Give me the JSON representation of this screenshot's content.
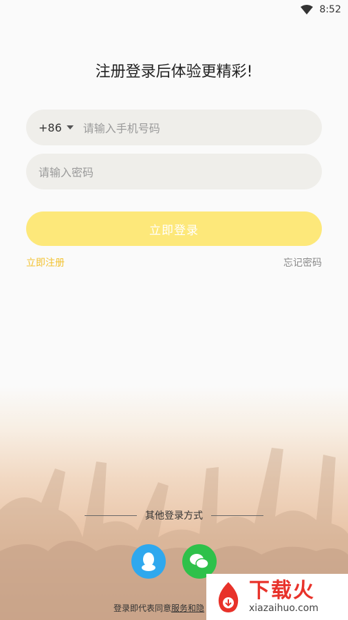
{
  "status_bar": {
    "time": "8:52"
  },
  "title": "注册登录后体验更精彩!",
  "phone_field": {
    "country_code": "+86",
    "placeholder": "请输入手机号码"
  },
  "password_field": {
    "placeholder": "请输入密码"
  },
  "login_button": "立即登录",
  "register_link": "立即注册",
  "forgot_link": "忘记密码",
  "other_login": "其他登录方式",
  "agreement": {
    "prefix": "登录即代表同意",
    "link_text": "服务和隐"
  },
  "watermark": {
    "cn": "下载火",
    "en": "xiazaihuo.com"
  },
  "colors": {
    "accent_yellow": "#fde87a",
    "link_yellow": "#f2c230",
    "qq_blue": "#2fa8ee",
    "wechat_green": "#2ec14a"
  }
}
